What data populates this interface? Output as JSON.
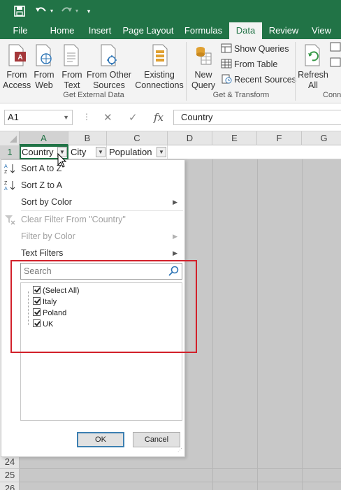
{
  "quick_access": {
    "icons": [
      "save-icon",
      "undo-icon",
      "redo-icon",
      "customize-icon"
    ]
  },
  "tabs": [
    {
      "label": "File",
      "active": false
    },
    {
      "label": "Home",
      "active": false
    },
    {
      "label": "Insert",
      "active": false
    },
    {
      "label": "Page Layout",
      "active": false
    },
    {
      "label": "Formulas",
      "active": false
    },
    {
      "label": "Data",
      "active": true
    },
    {
      "label": "Review",
      "active": false
    },
    {
      "label": "View",
      "active": false
    }
  ],
  "ribbon": {
    "from_access": "From\nAccess",
    "from_web": "From\nWeb",
    "from_text": "From\nText",
    "from_other": "From Other\nSources",
    "existing": "Existing\nConnections",
    "new_query": "New\nQuery",
    "show_queries": "Show Queries",
    "from_table": "From Table",
    "recent_sources": "Recent Sources",
    "refresh_all": "Refresh\nAll",
    "group_external": "Get External Data",
    "group_transform": "Get & Transform",
    "group_connections": "Conn"
  },
  "formula_bar": {
    "name_box": "A1",
    "cancel_icon": "✕",
    "enter_icon": "✓",
    "fx_icon": "fx",
    "content": "Country"
  },
  "columns": [
    "A",
    "B",
    "C",
    "D",
    "E",
    "F",
    "G"
  ],
  "rows": [
    "1",
    "24",
    "25",
    "26"
  ],
  "row1": {
    "a": "Country",
    "b": "City",
    "c": "Population"
  },
  "filter_menu": {
    "sort_az": "Sort A to Z",
    "sort_za": "Sort Z to A",
    "sort_color": "Sort by Color",
    "clear_filter": "Clear Filter From \"Country\"",
    "filter_color": "Filter by Color",
    "text_filters": "Text Filters",
    "search_placeholder": "Search",
    "items": [
      "(Select All)",
      "Italy",
      "Poland",
      "UK"
    ],
    "ok": "OK",
    "cancel": "Cancel"
  },
  "colors": {
    "brand": "#217346",
    "highlight": "#d2202a"
  }
}
